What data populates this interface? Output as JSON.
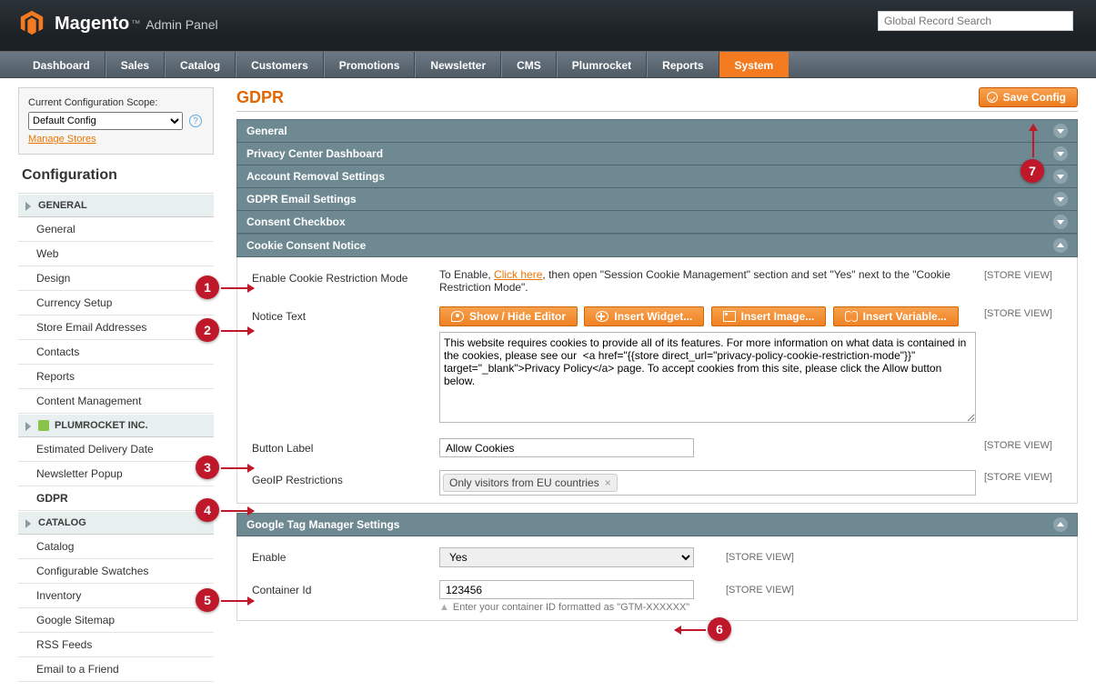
{
  "header": {
    "brand": "Magento",
    "brand_right": "Admin Panel",
    "search_placeholder": "Global Record Search"
  },
  "nav": [
    "Dashboard",
    "Sales",
    "Catalog",
    "Customers",
    "Promotions",
    "Newsletter",
    "CMS",
    "Plumrocket",
    "Reports",
    "System"
  ],
  "nav_active": "System",
  "scope": {
    "label": "Current Configuration Scope:",
    "value": "Default Config",
    "manage": "Manage Stores"
  },
  "sidebar": {
    "title": "Configuration",
    "groups": [
      {
        "title": "GENERAL",
        "items": [
          "General",
          "Web",
          "Design",
          "Currency Setup",
          "Store Email Addresses",
          "Contacts",
          "Reports",
          "Content Management"
        ]
      },
      {
        "title": "PLUMROCKET INC.",
        "icon": true,
        "items": [
          "Estimated Delivery Date",
          "Newsletter Popup",
          "GDPR"
        ],
        "active": "GDPR"
      },
      {
        "title": "CATALOG",
        "items": [
          "Catalog",
          "Configurable Swatches",
          "Inventory",
          "Google Sitemap",
          "RSS Feeds",
          "Email to a Friend"
        ]
      }
    ]
  },
  "page": {
    "title": "GDPR",
    "save": "Save Config"
  },
  "accordions": [
    "General",
    "Privacy Center Dashboard",
    "Account Removal Settings",
    "GDPR Email Settings",
    "Consent Checkbox"
  ],
  "cookieSection": {
    "title": "Cookie Consent Notice",
    "enable_label": "Enable Cookie Restriction Mode",
    "enable_text_before": "To Enable, ",
    "enable_link": "Click here",
    "enable_text_after": ", then open \"Session Cookie Management\" section and set \"Yes\" next to the \"Cookie Restriction Mode\".",
    "scope": "[STORE VIEW]",
    "notice_label": "Notice Text",
    "buttons": {
      "editor": "Show / Hide Editor",
      "widget": "Insert Widget...",
      "image": "Insert Image...",
      "variable": "Insert Variable..."
    },
    "notice_value": "This website requires cookies to provide all of its features. For more information on what data is contained in the cookies, please see our  <a href=\"{{store direct_url=\"privacy-policy-cookie-restriction-mode\"}}\" target=\"_blank\">Privacy Policy</a> page. To accept cookies from this site, please click the Allow button below.",
    "button_label_label": "Button Label",
    "button_label_value": "Allow Cookies",
    "geoip_label": "GeoIP Restrictions",
    "geoip_tag": "Only visitors from EU countries"
  },
  "gtmSection": {
    "title": "Google Tag Manager Settings",
    "enable_label": "Enable",
    "enable_value": "Yes",
    "gtm_scope": "[STORE VIEW]",
    "container_label": "Container Id",
    "container_value": "123456",
    "container_hint": "Enter your container ID formatted as \"GTM-XXXXXX\""
  },
  "callouts": [
    "1",
    "2",
    "3",
    "4",
    "5",
    "6",
    "7"
  ]
}
